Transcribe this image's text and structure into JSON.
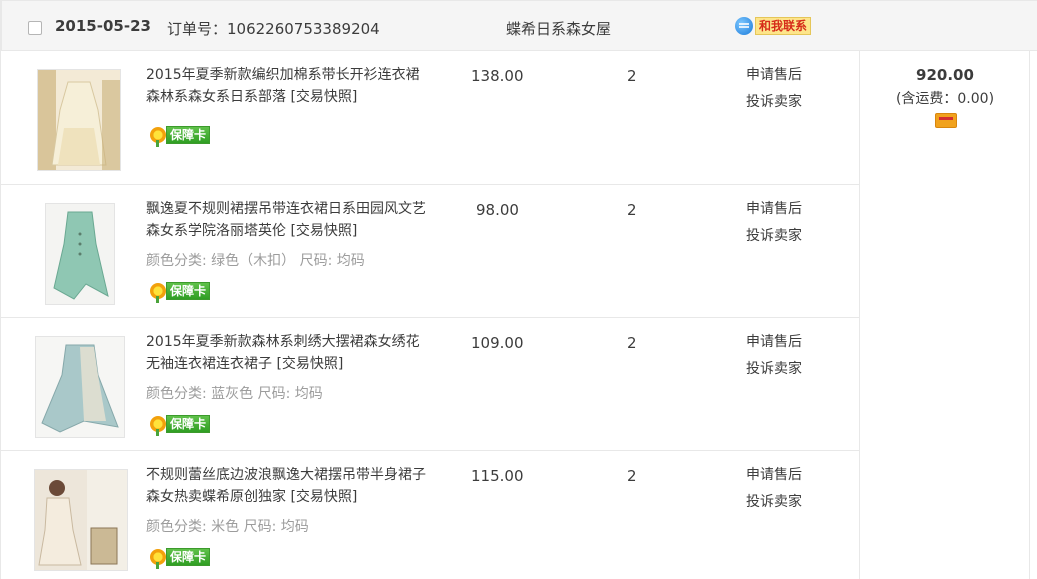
{
  "order": {
    "date": "2015-05-23",
    "order_label": "订单号：1062260753389204",
    "shop_name": "蝶希日系森女屋",
    "contact_label": "和我联系"
  },
  "items": [
    {
      "title": "2015年夏季新款编织加棉系带长开衫连衣裙森林系森女系日系部落",
      "snapshot": "[交易快照]",
      "attrs": "",
      "guarantee": "保障卡",
      "price": "138.00",
      "qty": "2",
      "op1": "申请售后",
      "op2": "投诉卖家"
    },
    {
      "title": "飘逸夏不规则裙摆吊带连衣裙日系田园风文艺森女系学院洛丽塔英伦",
      "snapshot": "[交易快照]",
      "attrs": "颜色分类: 绿色（木扣） 尺码: 均码",
      "guarantee": "保障卡",
      "price": "98.00",
      "qty": "2",
      "op1": "申请售后",
      "op2": "投诉卖家"
    },
    {
      "title": "2015年夏季新款森林系刺绣大摆裙森女绣花无袖连衣裙连衣裙子",
      "snapshot": "[交易快照]",
      "attrs": "颜色分类: 蓝灰色 尺码: 均码",
      "guarantee": "保障卡",
      "price": "109.00",
      "qty": "2",
      "op1": "申请售后",
      "op2": "投诉卖家"
    },
    {
      "title": "不规则蕾丝底边波浪飘逸大裙摆吊带半身裙子森女热卖蝶希原创独家",
      "snapshot": "[交易快照]",
      "attrs": "颜色分类: 米色 尺码: 均码",
      "guarantee": "保障卡",
      "price": "115.00",
      "qty": "2",
      "op1": "申请售后",
      "op2": "投诉卖家"
    }
  ],
  "summary": {
    "total": "920.00",
    "shipping": "(含运费：0.00)"
  },
  "icons": {
    "contact": "chat-bubble-icon",
    "guarantee": "flower-icon",
    "payment": "credit-card-icon"
  }
}
